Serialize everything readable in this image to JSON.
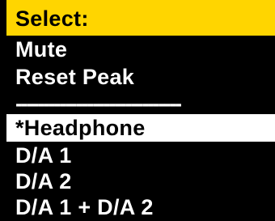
{
  "menu": {
    "title": "Select:",
    "items": [
      {
        "label": "Mute"
      },
      {
        "label": "Reset Peak"
      }
    ],
    "separator": "------------------------------",
    "outputs": [
      {
        "label": "*Headphone",
        "selected": true
      },
      {
        "label": "D/A 1",
        "selected": false
      },
      {
        "label": "D/A 2",
        "selected": false
      },
      {
        "label": "D/A 1 + D/A 2",
        "selected": false
      }
    ]
  },
  "colors": {
    "header_background": "#ffd500",
    "menu_background": "#000000",
    "selected_background": "#ffffff",
    "text": "#ffffff",
    "selected_text": "#000000"
  }
}
